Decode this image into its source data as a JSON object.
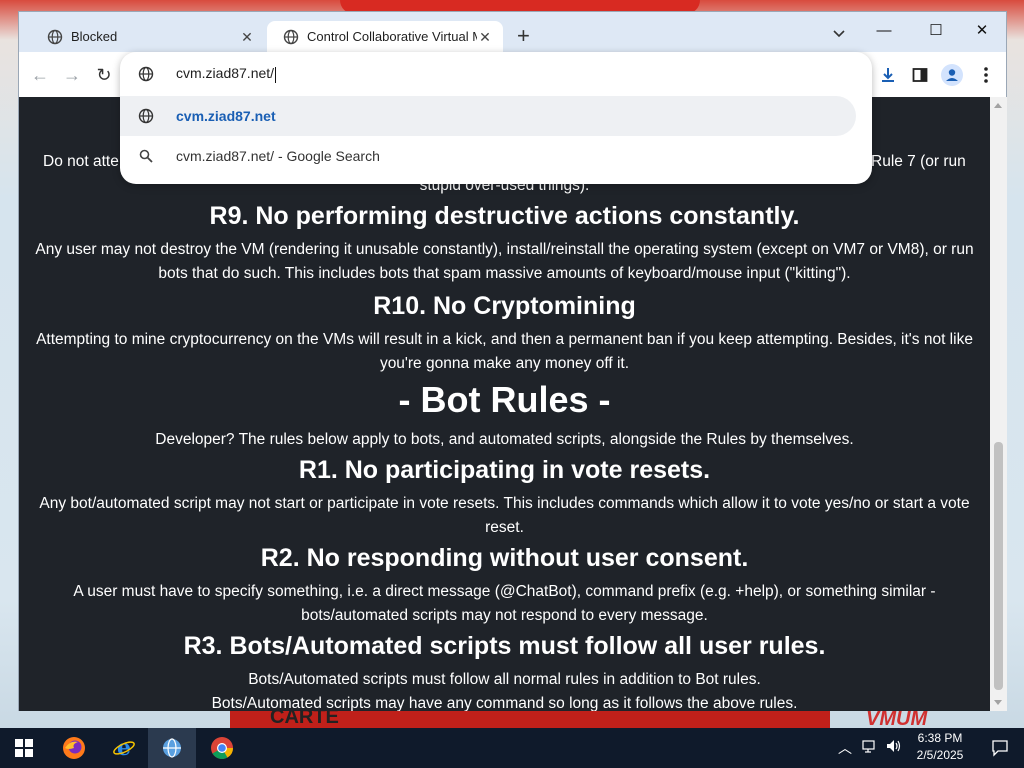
{
  "window": {
    "minimize_glyph": "—",
    "maximize_glyph": "☐",
    "close_glyph": "✕"
  },
  "tabs": [
    {
      "title": "Blocked",
      "icon": "globe-icon",
      "active": false
    },
    {
      "title": "Control Collaborative Virtual Ma",
      "icon": "globe-icon",
      "active": true
    }
  ],
  "toolbar": {
    "back_glyph": "←",
    "forward_glyph": "→",
    "reload_glyph": "↻",
    "address": "cvm.ziad87.net/"
  },
  "omnibox": {
    "suggestions": [
      {
        "text": "cvm.ziad87.net",
        "icon": "globe-icon",
        "selected": true
      },
      {
        "text": "cvm.ziad87.net/ - Google Search",
        "icon": "search-icon",
        "selected": false
      }
    ]
  },
  "content": {
    "partial_top_left": "Do not atte",
    "partial_top_right": "Rule 7 (or run",
    "partial_top_line2": "stupid over-used things).",
    "sections": [
      {
        "heading": "R9. No performing destructive actions constantly.",
        "body": "Any user may not destroy the VM (rendering it unusable constantly), install/reinstall the operating system (except on VM7 or VM8), or run bots that do such. This includes bots that spam massive amounts of keyboard/mouse input (\"kitting\")."
      },
      {
        "heading": "R10. No Cryptomining",
        "body": "Attempting to mine cryptocurrency on the VMs will result in a kick, and then a permanent ban if you keep attempting. Besides, it's not like you're gonna make any money off it."
      }
    ],
    "bot_title": "- Bot Rules -",
    "bot_intro": "Developer? The rules below apply to bots, and automated scripts, alongside the Rules by themselves.",
    "bot_sections": [
      {
        "heading": "R1. No participating in vote resets.",
        "body": "Any bot/automated script may not start or participate in vote resets. This includes commands which allow it to vote yes/no or start a vote reset."
      },
      {
        "heading": "R2. No responding without user consent.",
        "body": "A user must have to specify something, i.e. a direct message (@ChatBot), command prefix (e.g. +help), or something similar - bots/automated scripts may not respond to every message."
      },
      {
        "heading": "R3. Bots/Automated scripts must follow all user rules.",
        "body": "Bots/Automated scripts must follow all normal rules in addition to Bot rules."
      }
    ],
    "last_line": "Bots/Automated scripts may have any command so long as it follows the above rules."
  },
  "desktop": {
    "bottom_text": "CARTE",
    "right_text": "VMUM"
  },
  "taskbar": {
    "apps": [
      {
        "name": "firefox",
        "icon": "firefox-icon"
      },
      {
        "name": "internet-explorer",
        "icon": "internet-explorer-icon"
      },
      {
        "name": "network-app",
        "icon": "network-globe-icon"
      },
      {
        "name": "chrome",
        "icon": "chrome-icon"
      }
    ],
    "time": "6:38 PM",
    "date": "2/5/2025"
  },
  "colors": {
    "content_bg": "#1f2329",
    "accent": "#1a73e8",
    "taskbar_bg": "#0f1a2b"
  }
}
